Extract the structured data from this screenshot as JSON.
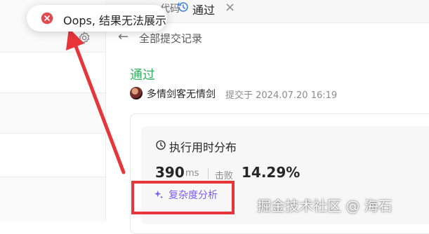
{
  "tabs": {
    "prev_label": "代码",
    "active_label": "通过",
    "close_glyph": "×"
  },
  "toolbar": {
    "back_arrow": "←",
    "back_label": "全部提交记录"
  },
  "submission": {
    "status": "通过",
    "author": "多情剑客无情剑",
    "submitted_text": "提交于 2024.07.20 16:19"
  },
  "runtime": {
    "title": "执行用时分布",
    "value": "390",
    "unit": "ms",
    "beats_label": "击败",
    "beats_value": "14.29%"
  },
  "complexity": {
    "label": "复杂度分析"
  },
  "toast": {
    "message": "Oops, 结果无法展示"
  },
  "watermark": "掘金技术社区 @ 海石",
  "icons": [
    "gear-icon",
    "history-icon",
    "close-icon",
    "back-arrow-icon",
    "clock-icon",
    "sparkle-icon",
    "error-icon"
  ],
  "colors": {
    "success": "#2db55d",
    "accent_purple": "#7a5cff",
    "annotation_red": "#e8353a",
    "error_red": "#e5484d"
  }
}
